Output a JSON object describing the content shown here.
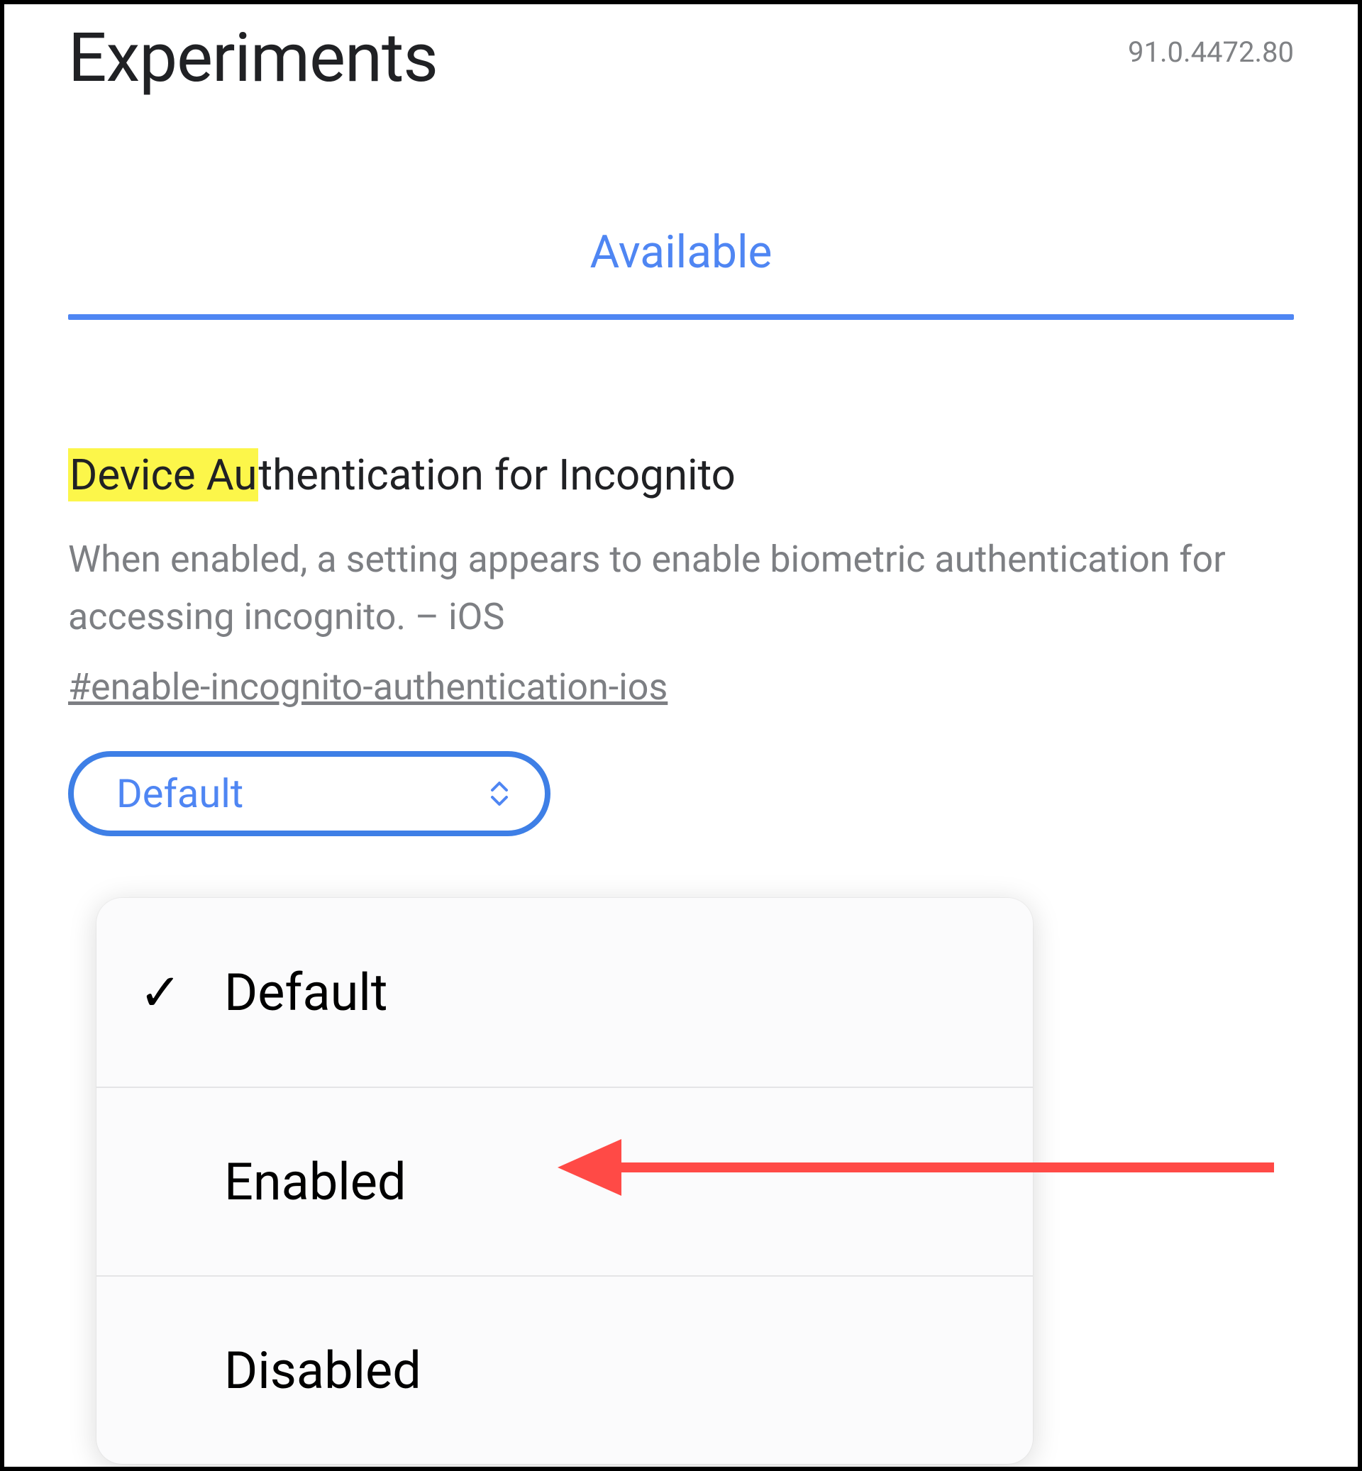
{
  "header": {
    "title": "Experiments",
    "version": "91.0.4472.80"
  },
  "tabs": {
    "active": "Available"
  },
  "experiment": {
    "title_highlight": "Device Au",
    "title_rest": "thentication for Incognito",
    "description": "When enabled, a setting appears to enable biometric authentication for accessing incognito. – iOS",
    "hash": "#enable-incognito-authentication-ios",
    "dropdown_value": "Default"
  },
  "popup": {
    "options": [
      {
        "label": "Default",
        "selected": true
      },
      {
        "label": "Enabled",
        "selected": false
      },
      {
        "label": "Disabled",
        "selected": false
      }
    ]
  },
  "colors": {
    "accent": "#4f86f3",
    "highlight": "#fcf64a",
    "annotation": "#ff4a46"
  }
}
